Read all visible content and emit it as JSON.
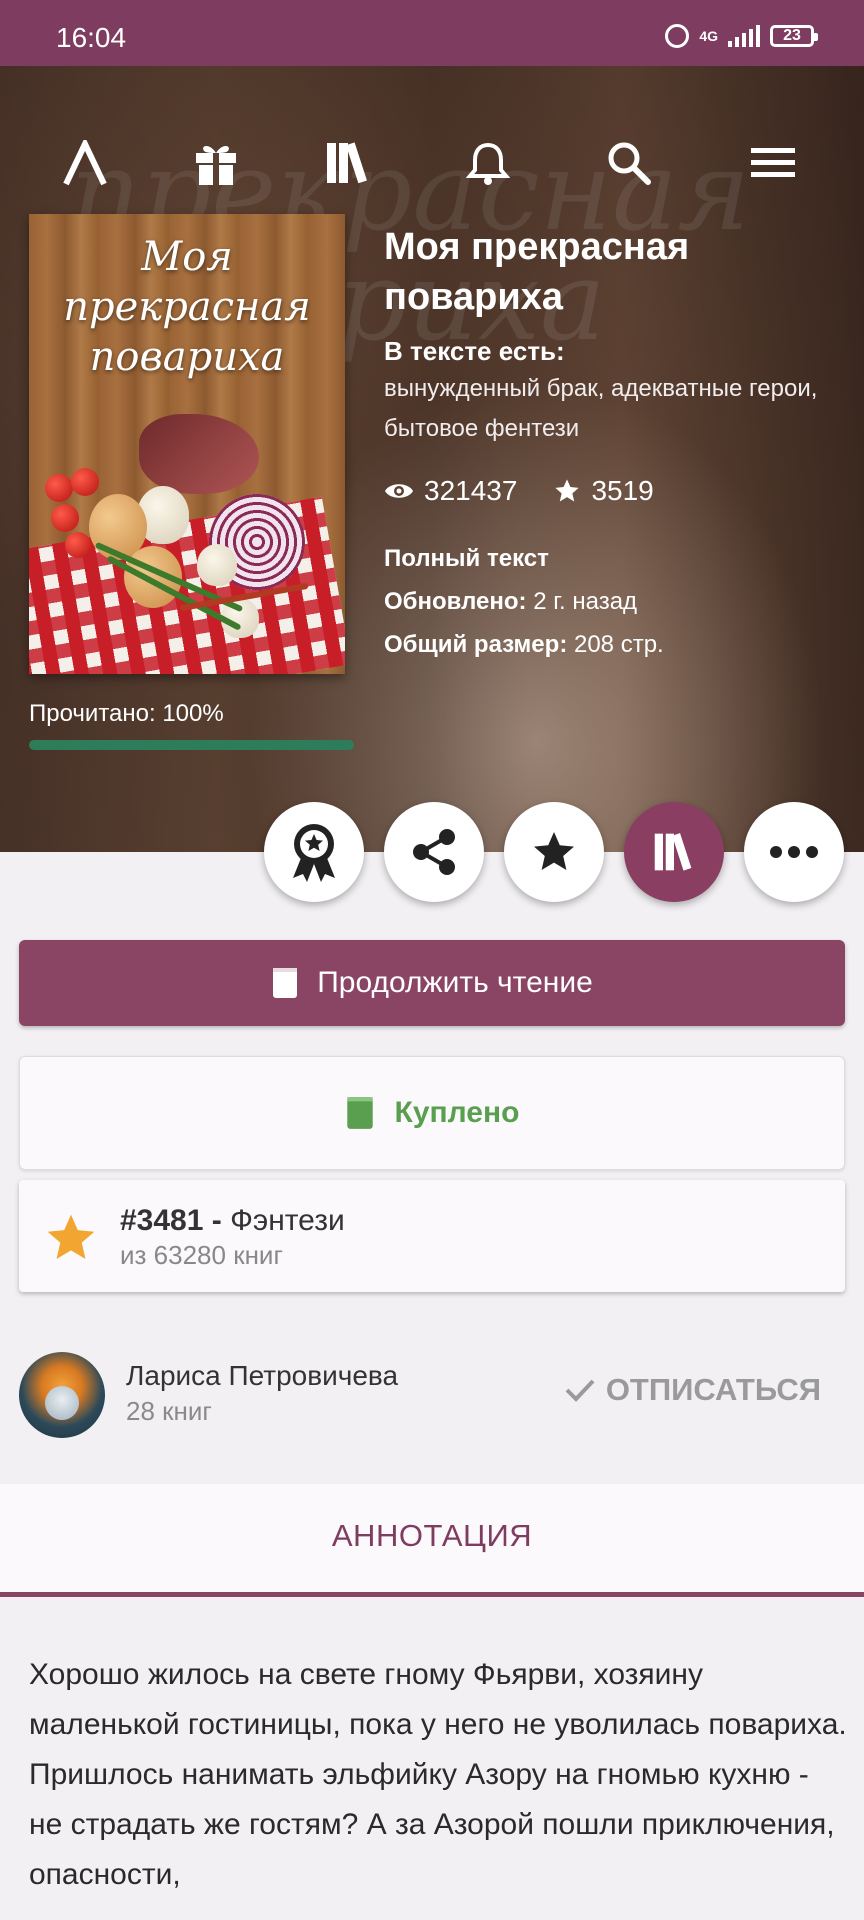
{
  "status_bar": {
    "time": "16:04",
    "network": "4G",
    "battery": "23"
  },
  "top_nav": {
    "icons": [
      "logo-icon",
      "gift-icon",
      "library-icon",
      "bell-icon",
      "search-icon",
      "menu-icon"
    ]
  },
  "cover": {
    "title": "Моя\nпрекрасная\nповариха"
  },
  "book": {
    "title": "Моя прекрасная повариха",
    "tags_label": "В тексте есть:",
    "tags": "вынужденный брак, адекватные герои, бытовое фентези",
    "views": "321437",
    "likes": "3519",
    "status": "Полный текст",
    "updated_label": "Обновлено:",
    "updated_value": "2 г. назад",
    "size_label": "Общий размер:",
    "size_value": "208 стр."
  },
  "progress": {
    "label": "Прочитано: 100%",
    "fraction": 1.0
  },
  "actions": {
    "icons": [
      "award-icon",
      "share-icon",
      "star-icon",
      "library-icon",
      "more-icon"
    ],
    "active": "library-icon"
  },
  "buttons": {
    "continue": "Продолжить чтение",
    "bought": "Куплено"
  },
  "rank": {
    "position": "#3481 -",
    "genre": "Фэнтези",
    "total": "из 63280 книг"
  },
  "author": {
    "name": "Лариса Петровичева",
    "books": "28 книг",
    "unsubscribe": "ОТПИСАТЬСЯ"
  },
  "tabs": {
    "annotation": "АННОТАЦИЯ"
  },
  "annotation": {
    "text": "Хорошо жилось на свете гному Фьярви, хозяину маленькой гостиницы, пока у него не уволилась повариха. Пришлось нанимать эльфийку Азору на гномью кухню - не страдать же гостям? А за Азорой пошли приключения, опасности,"
  },
  "colors": {
    "brand": "#7e3d60",
    "accent": "#8a4564",
    "bought": "#5a9e4f",
    "progress": "#2e7d5a",
    "rank_star": "#f2a531"
  }
}
